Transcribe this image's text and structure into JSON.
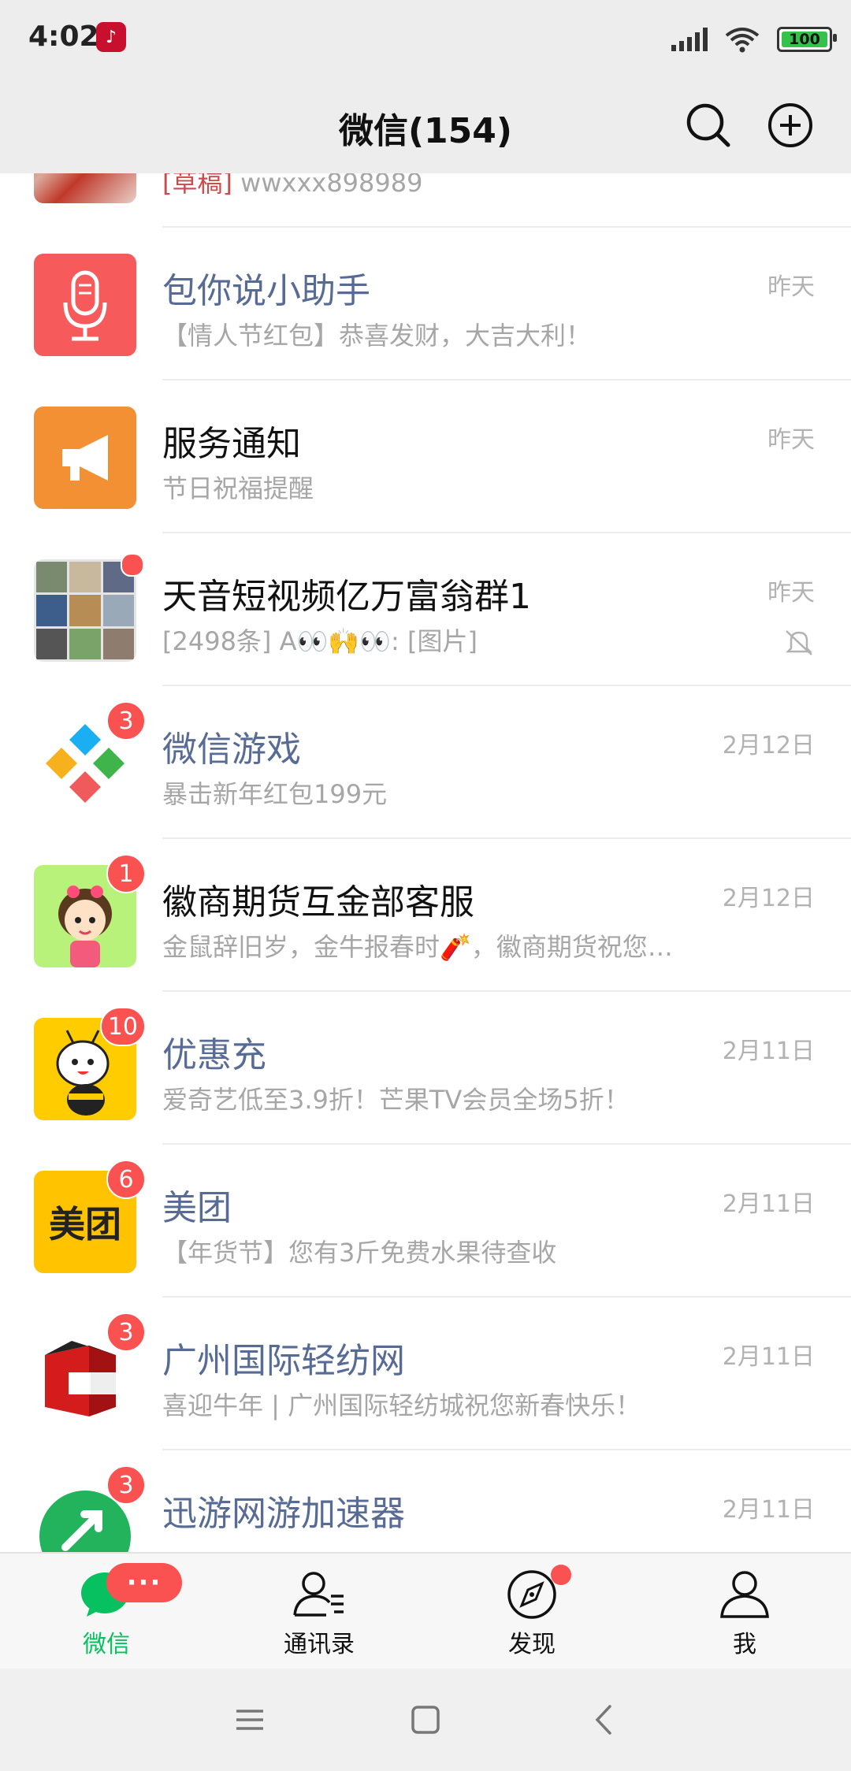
{
  "status_bar": {
    "time": "4:02",
    "app_icon_text": "♪",
    "battery": "100"
  },
  "header": {
    "title": "微信(154)"
  },
  "chats": [
    {
      "name": "",
      "preview_prefix": "[草稿]",
      "preview": " wwxxx898989",
      "time": "",
      "badge": "",
      "official": false
    },
    {
      "name": "包你说小助手",
      "preview_prefix": "",
      "preview": "【情人节红包】恭喜发财，大吉大利！",
      "time": "昨天",
      "badge": "",
      "official": true
    },
    {
      "name": "服务通知",
      "preview_prefix": "",
      "preview": "节日祝福提醒",
      "time": "昨天",
      "badge": "",
      "official": false
    },
    {
      "name": "天音短视频亿万富翁群1",
      "preview_prefix": "",
      "preview": "[2498条] A👀🙌👀: [图片]",
      "time": "昨天",
      "badge": "",
      "official": false
    },
    {
      "name": "微信游戏",
      "preview_prefix": "",
      "preview": "暴击新年红包199元",
      "time": "2月12日",
      "badge": "3",
      "official": true
    },
    {
      "name": "徽商期货互金部客服",
      "preview_prefix": "",
      "preview": "金鼠辞旧岁，金牛报春时🧨，徽商期货祝您…",
      "time": "2月12日",
      "badge": "1",
      "official": false
    },
    {
      "name": "优惠充",
      "preview_prefix": "",
      "preview": "爱奇艺低至3.9折！芒果TV会员全场5折！",
      "time": "2月11日",
      "badge": "10",
      "official": true
    },
    {
      "name": "美团",
      "preview_prefix": "",
      "preview": "【年货节】您有3斤免费水果待查收",
      "time": "2月11日",
      "badge": "6",
      "official": true
    },
    {
      "name": "广州国际轻纺网",
      "preview_prefix": "",
      "preview": "喜迎牛年 | 广州国际轻纺城祝您新春快乐！",
      "time": "2月11日",
      "badge": "3",
      "official": true
    },
    {
      "name": "迅游网游加速器",
      "preview_prefix": "",
      "preview": "",
      "time": "2月11日",
      "badge": "3",
      "official": true
    }
  ],
  "meituan_logo_text": "美团",
  "tabbar": {
    "tabs": [
      {
        "label": "微信",
        "badge": "···",
        "active": true
      },
      {
        "label": "通讯录",
        "badge": "",
        "active": false
      },
      {
        "label": "发现",
        "badge": "",
        "active": false
      },
      {
        "label": "我",
        "badge": "",
        "active": false
      }
    ]
  },
  "colors": {
    "accent": "#07c160",
    "badge": "#fa5151",
    "official_name": "#576b95",
    "draft": "#c94c4c"
  }
}
